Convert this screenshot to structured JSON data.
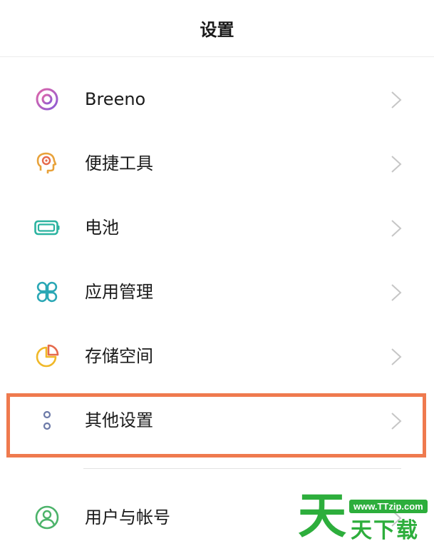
{
  "header": {
    "title": "设置"
  },
  "items": [
    {
      "label": "Breeno",
      "icon": "breeno-icon"
    },
    {
      "label": "便捷工具",
      "icon": "convenience-tools-icon"
    },
    {
      "label": "电池",
      "icon": "battery-icon"
    },
    {
      "label": "应用管理",
      "icon": "app-management-icon"
    },
    {
      "label": "存储空间",
      "icon": "storage-icon"
    },
    {
      "label": "其他设置",
      "icon": "other-settings-icon"
    },
    {
      "label": "用户与帐号",
      "icon": "user-account-icon"
    }
  ],
  "highlight_color": "#ef7a4e",
  "watermark": {
    "big": "天",
    "url": "www.TTzip.com",
    "small": "天下载"
  }
}
